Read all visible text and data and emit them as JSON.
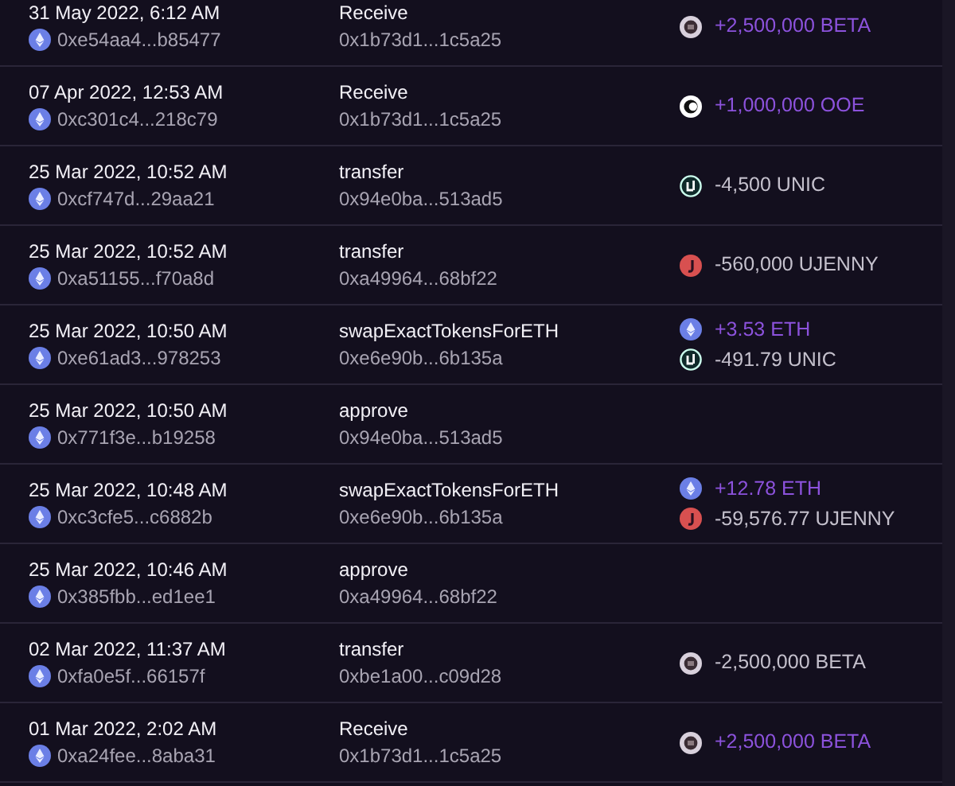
{
  "transactions": [
    {
      "date": "31 May 2022, 6:12 AM",
      "hash": "0xe54aa4...b85477",
      "method": "Receive",
      "address": "0x1b73d1...1c5a25",
      "amounts": [
        {
          "kind": "beta",
          "incoming": true,
          "text": "+2,500,000 BETA"
        }
      ]
    },
    {
      "date": "07 Apr 2022, 12:53 AM",
      "hash": "0xc301c4...218c79",
      "method": "Receive",
      "address": "0x1b73d1...1c5a25",
      "amounts": [
        {
          "kind": "ooe",
          "incoming": true,
          "text": "+1,000,000 OOE"
        }
      ]
    },
    {
      "date": "25 Mar 2022, 10:52 AM",
      "hash": "0xcf747d...29aa21",
      "method": "transfer",
      "address": "0x94e0ba...513ad5",
      "amounts": [
        {
          "kind": "unic",
          "incoming": false,
          "text": "-4,500 UNIC"
        }
      ]
    },
    {
      "date": "25 Mar 2022, 10:52 AM",
      "hash": "0xa51155...f70a8d",
      "method": "transfer",
      "address": "0xa49964...68bf22",
      "amounts": [
        {
          "kind": "ujenny",
          "incoming": false,
          "text": "-560,000 UJENNY"
        }
      ]
    },
    {
      "date": "25 Mar 2022, 10:50 AM",
      "hash": "0xe61ad3...978253",
      "method": "swapExactTokensForETH",
      "address": "0xe6e90b...6b135a",
      "amounts": [
        {
          "kind": "eth",
          "incoming": true,
          "text": "+3.53 ETH"
        },
        {
          "kind": "unic",
          "incoming": false,
          "text": "-491.79 UNIC"
        }
      ]
    },
    {
      "date": "25 Mar 2022, 10:50 AM",
      "hash": "0x771f3e...b19258",
      "method": "approve",
      "address": "0x94e0ba...513ad5"
    },
    {
      "date": "25 Mar 2022, 10:48 AM",
      "hash": "0xc3cfe5...c6882b",
      "method": "swapExactTokensForETH",
      "address": "0xe6e90b...6b135a",
      "amounts": [
        {
          "kind": "eth",
          "incoming": true,
          "text": "+12.78 ETH"
        },
        {
          "kind": "ujenny",
          "incoming": false,
          "text": "-59,576.77 UJENNY"
        }
      ]
    },
    {
      "date": "25 Mar 2022, 10:46 AM",
      "hash": "0x385fbb...ed1ee1",
      "method": "approve",
      "address": "0xa49964...68bf22"
    },
    {
      "date": "02 Mar 2022, 11:37 AM",
      "hash": "0xfa0e5f...66157f",
      "method": "transfer",
      "address": "0xbe1a00...c09d28",
      "amounts": [
        {
          "kind": "beta",
          "incoming": false,
          "text": "-2,500,000 BETA"
        }
      ]
    },
    {
      "date": "01 Mar 2022, 2:02 AM",
      "hash": "0xa24fee...8aba31",
      "method": "Receive",
      "address": "0x1b73d1...1c5a25",
      "amounts": [
        {
          "kind": "beta",
          "incoming": true,
          "text": "+2,500,000 BETA"
        }
      ]
    }
  ]
}
